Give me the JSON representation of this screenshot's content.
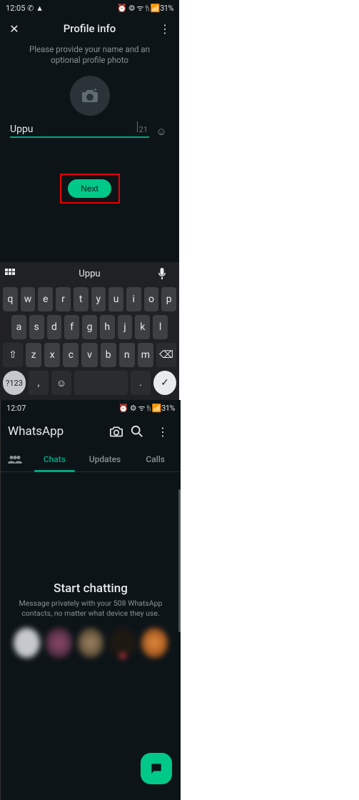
{
  "left": {
    "status": {
      "time": "12:05",
      "icons": "✆ ▲",
      "right": "⏰ ⚙ ᯤ ⫯ᵢ 📶31%"
    },
    "header": {
      "title": "Profile info"
    },
    "subtitle": "Please provide your name and an optional profile photo",
    "name": {
      "value": "Uppu",
      "remaining": "21"
    },
    "next": "Next",
    "keyboard": {
      "suggestion": "Uppu",
      "row1": [
        "q",
        "w",
        "e",
        "r",
        "t",
        "y",
        "u",
        "i",
        "o",
        "p"
      ],
      "row2": [
        "a",
        "s",
        "d",
        "f",
        "g",
        "h",
        "j",
        "k",
        "l"
      ],
      "row3": [
        "z",
        "x",
        "c",
        "v",
        "b",
        "n",
        "m"
      ],
      "sym": "?123",
      "comma": ",",
      "period": "."
    }
  },
  "right": {
    "status": {
      "time": "12:07",
      "right": "⏰ ⚙ ᯤ ⫯ᵢ 📶31%"
    },
    "app": "WhatsApp",
    "tabs": {
      "chats": "Chats",
      "updates": "Updates",
      "calls": "Calls"
    },
    "start": {
      "title": "Start chatting",
      "sub": "Message privately with your 508 WhatsApp contacts, no matter what device they use."
    }
  }
}
